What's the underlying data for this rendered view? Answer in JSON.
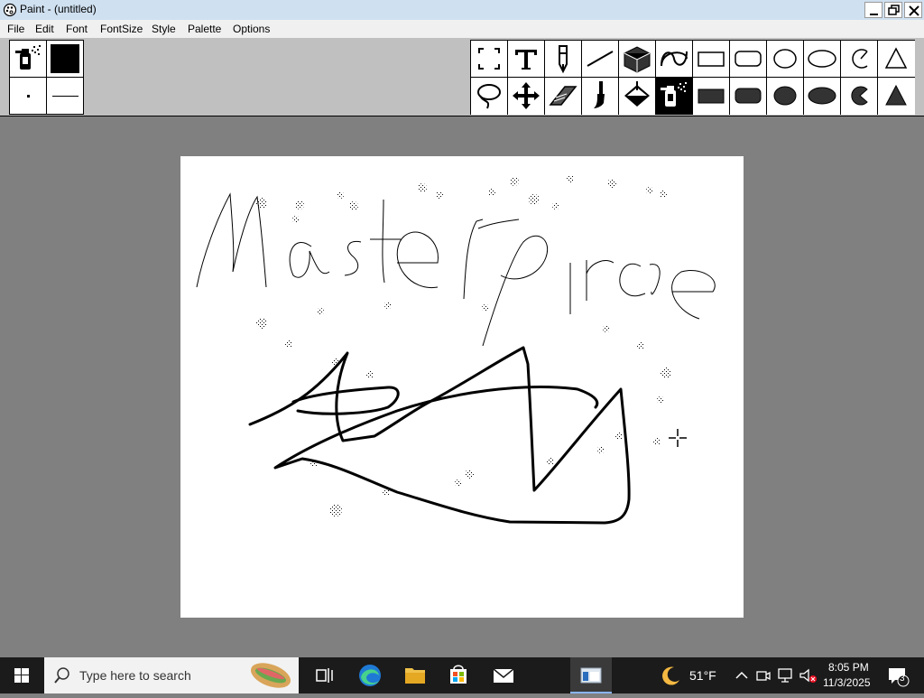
{
  "window": {
    "title": "Paint - (untitled)"
  },
  "menu": [
    "File",
    "Edit",
    "Font",
    "FontSize",
    "Style",
    "Palette",
    "Options"
  ],
  "tools": {
    "row1": [
      "select-icon",
      "text-icon",
      "pencil-icon",
      "line-icon",
      "box-3d-icon",
      "freeform-curve-icon",
      "rectangle-icon",
      "rounded-rectangle-icon",
      "ellipse-icon",
      "ellipse-wide-icon",
      "arc-icon",
      "triangle-icon"
    ],
    "row2": [
      "lasso-icon",
      "move-icon",
      "eraser-icon",
      "brush-icon",
      "paint-bucket-icon",
      "airbrush-icon",
      "filled-rectangle-icon",
      "filled-rounded-rectangle-icon",
      "filled-ellipse-icon",
      "filled-ellipse-wide-icon",
      "filled-pie-icon",
      "filled-triangle-icon"
    ],
    "selected": "airbrush-icon"
  },
  "colors": {
    "foreground": "#000000",
    "accent_taskbar": "#1b1b1b"
  },
  "taskbar": {
    "search_placeholder": "Type here to search",
    "weather": "51°F",
    "time": "8:05 PM",
    "date": "11/3/2025",
    "notification_count": "3"
  }
}
